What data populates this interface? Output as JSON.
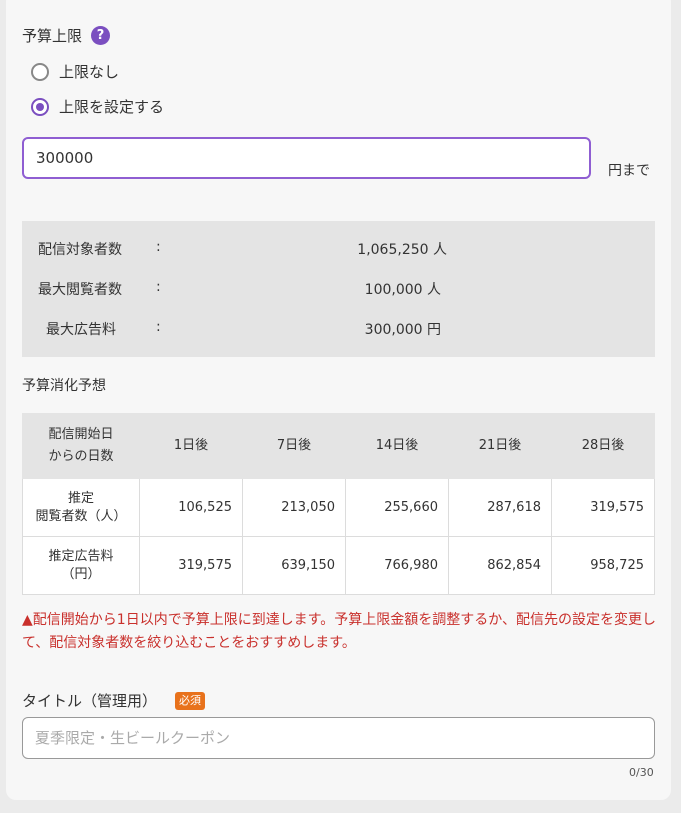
{
  "budget": {
    "label": "予算上限",
    "help_icon_glyph": "?",
    "options": [
      {
        "label": "上限なし",
        "selected": false
      },
      {
        "label": "上限を設定する",
        "selected": true
      }
    ],
    "input_value": "300000",
    "unit_suffix": "円まで"
  },
  "stats": {
    "colon": ":",
    "rows": [
      {
        "label": "配信対象者数",
        "value": "1,065,250 人"
      },
      {
        "label": "最大閲覧者数",
        "value": "100,000 人"
      },
      {
        "label": "最大広告料",
        "value": "300,000 円"
      }
    ]
  },
  "forecast": {
    "title": "予算消化予想",
    "corner_header_line1": "配信開始日",
    "corner_header_line2": "からの日数",
    "columns": [
      "1日後",
      "7日後",
      "14日後",
      "21日後",
      "28日後"
    ],
    "rows": [
      {
        "label_line1": "推定",
        "label_line2": "閲覧者数（人）",
        "values": [
          "106,525",
          "213,050",
          "255,660",
          "287,618",
          "319,575"
        ]
      },
      {
        "label_line1": "推定広告料",
        "label_line2": "（円）",
        "values": [
          "319,575",
          "639,150",
          "766,980",
          "862,854",
          "958,725"
        ]
      }
    ]
  },
  "warning": {
    "icon_glyph": "▲",
    "text": "配信開始から1日以内で予算上限に到達します。予算上限金額を調整するか、配信先の設定を変更して、配信対象者数を絞り込むことをおすすめします。"
  },
  "title_field": {
    "label": "タイトル（管理用）",
    "required_badge": "必須",
    "value": "",
    "placeholder": "夏季限定・生ビールクーポン",
    "counter": "0/30"
  },
  "colors": {
    "accent": "#7b4fc0",
    "input_focus_border": "#8f5ed2",
    "warning": "#c9302c",
    "required_badge": "#e8721c"
  },
  "icons": {
    "help": "question-circle-icon",
    "warning": "warning-triangle-icon"
  }
}
